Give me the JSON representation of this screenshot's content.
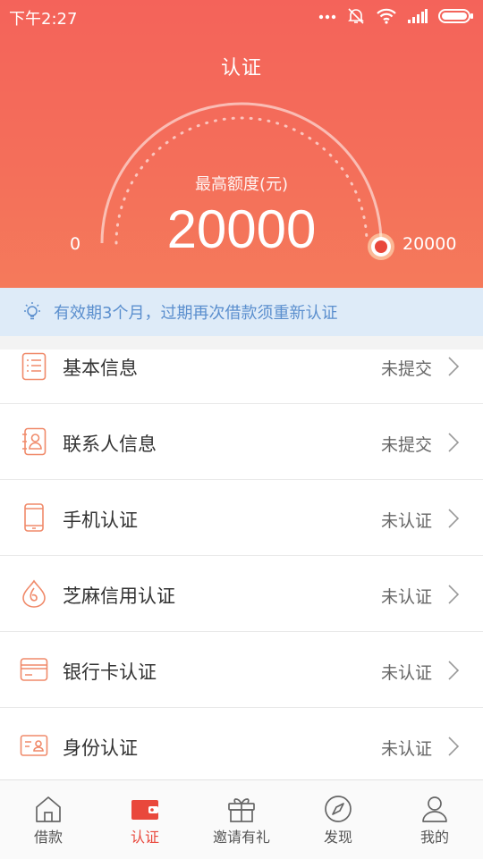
{
  "status_bar": {
    "time": "下午2:27"
  },
  "header": {
    "title": "认证",
    "quota_label": "最高额度(元)",
    "quota_value": "20000",
    "gauge_min": "0",
    "gauge_max": "20000",
    "gauge_fill_fraction": 1.0
  },
  "notice": {
    "text": "有效期3个月，过期再次借款须重新认证"
  },
  "items": [
    {
      "label": "基本信息",
      "status": "未提交",
      "icon": "form-list-icon"
    },
    {
      "label": "联系人信息",
      "status": "未提交",
      "icon": "contact-card-icon"
    },
    {
      "label": "手机认证",
      "status": "未认证",
      "icon": "phone-icon"
    },
    {
      "label": "芝麻信用认证",
      "status": "未认证",
      "icon": "sesame-credit-icon"
    },
    {
      "label": "银行卡认证",
      "status": "未认证",
      "icon": "bank-card-icon"
    },
    {
      "label": "身份认证",
      "status": "未认证",
      "icon": "id-card-icon"
    }
  ],
  "tabs": [
    {
      "label": "借款",
      "icon": "home-icon",
      "active": false
    },
    {
      "label": "认证",
      "icon": "wallet-icon",
      "active": true
    },
    {
      "label": "邀请有礼",
      "icon": "gift-icon",
      "active": false
    },
    {
      "label": "发现",
      "icon": "compass-icon",
      "active": false
    },
    {
      "label": "我的",
      "icon": "person-icon",
      "active": false
    }
  ],
  "colors": {
    "header": "#f4635a",
    "accent": "#e9483c",
    "notice_bg": "#deebf8",
    "notice_text": "#5b8fce",
    "icon": "#f08a6a"
  }
}
